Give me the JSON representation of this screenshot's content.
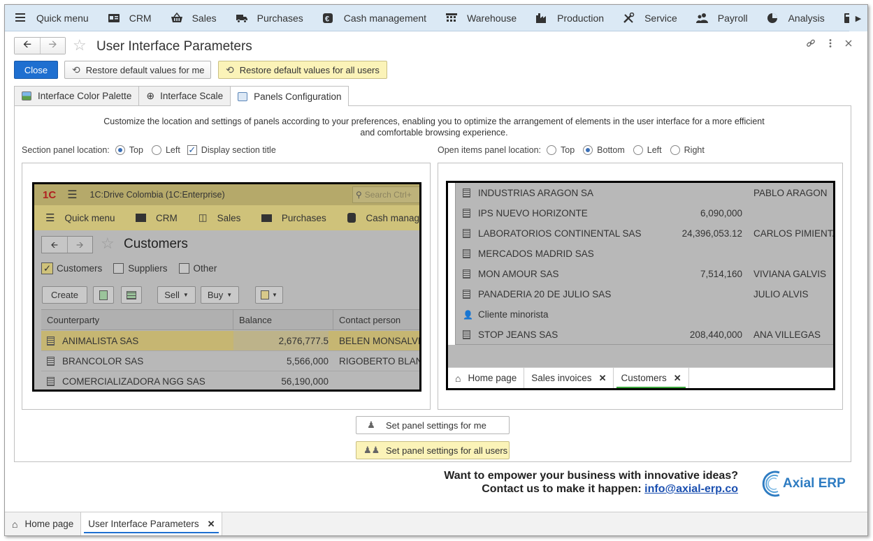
{
  "topmenu": {
    "items": [
      {
        "label": "Quick menu",
        "icon": "hamburger-icon"
      },
      {
        "label": "CRM",
        "icon": "crm-card-icon"
      },
      {
        "label": "Sales",
        "icon": "basket-icon"
      },
      {
        "label": "Purchases",
        "icon": "truck-icon"
      },
      {
        "label": "Cash management",
        "icon": "cash-icon"
      },
      {
        "label": "Warehouse",
        "icon": "warehouse-icon"
      },
      {
        "label": "Production",
        "icon": "factory-icon"
      },
      {
        "label": "Service",
        "icon": "tools-icon"
      },
      {
        "label": "Payroll",
        "icon": "people-icon"
      },
      {
        "label": "Analysis",
        "icon": "pie-chart-icon"
      }
    ]
  },
  "header": {
    "title": "User Interface Parameters"
  },
  "actions": {
    "close": "Close",
    "restore_me": "Restore default values for me",
    "restore_all": "Restore default values for all users"
  },
  "tabs": [
    {
      "label": "Interface Color Palette"
    },
    {
      "label": "Interface Scale"
    },
    {
      "label": "Panels Configuration"
    }
  ],
  "panels": {
    "description": "Customize the location and settings of panels according to your preferences, enabling you to optimize the arrangement of elements in the user interface for a more efficient and comfortable browsing experience.",
    "section_label": "Section panel location:",
    "section_options": [
      "Top",
      "Left"
    ],
    "section_selected": "Top",
    "display_title": "Display section title",
    "display_title_checked": true,
    "open_label": "Open items panel location:",
    "open_options": [
      "Top",
      "Bottom",
      "Left",
      "Right"
    ],
    "open_selected": "Bottom",
    "set_me": "Set panel settings for me",
    "set_all": "Set panel settings for all users"
  },
  "preview_left": {
    "app_title": "1C:Drive Colombia  (1C:Enterprise)",
    "search_placeholder": "Search Ctrl+",
    "menu": [
      "Quick menu",
      "CRM",
      "Sales",
      "Purchases",
      "Cash manag"
    ],
    "form_title": "Customers",
    "filters": [
      {
        "label": "Customers",
        "checked": true
      },
      {
        "label": "Suppliers",
        "checked": false
      },
      {
        "label": "Other",
        "checked": false
      }
    ],
    "buttons": {
      "create": "Create",
      "sell": "Sell",
      "buy": "Buy"
    },
    "columns": [
      "Counterparty",
      "Balance",
      "Contact person"
    ],
    "rows": [
      {
        "name": "ANIMALISTA SAS",
        "balance": "2,676,777.5",
        "contact": "BELEN MONSALVE"
      },
      {
        "name": "BRANCOLOR SAS",
        "balance": "5,566,000",
        "contact": "RIGOBERTO BLAN"
      },
      {
        "name": "COMERCIALIZADORA NGG SAS",
        "balance": "56,190,000",
        "contact": ""
      }
    ]
  },
  "preview_right": {
    "rows": [
      {
        "name": "INDUSTRIAS ARAGON SA",
        "balance": "",
        "contact": "PABLO ARAGON",
        "icon": "building-icon"
      },
      {
        "name": "IPS NUEVO HORIZONTE",
        "balance": "6,090,000",
        "contact": "",
        "icon": "building-icon"
      },
      {
        "name": "LABORATORIOS CONTINENTAL SAS",
        "balance": "24,396,053.12",
        "contact": "CARLOS PIMIENTA",
        "icon": "building-icon"
      },
      {
        "name": "MERCADOS MADRID SAS",
        "balance": "",
        "contact": "",
        "icon": "building-icon"
      },
      {
        "name": "MON AMOUR SAS",
        "balance": "7,514,160",
        "contact": "VIVIANA GALVIS",
        "icon": "building-icon"
      },
      {
        "name": "PANADERIA 20 DE JULIO SAS",
        "balance": "",
        "contact": "JULIO ALVIS",
        "icon": "building-icon"
      },
      {
        "name": "Cliente minorista",
        "balance": "",
        "contact": "",
        "icon": "person-icon"
      },
      {
        "name": "STOP JEANS SAS",
        "balance": "208,440,000",
        "contact": "ANA VILLEGAS",
        "icon": "building-icon"
      }
    ],
    "tabs": [
      "Home page",
      "Sales invoices",
      "Customers"
    ]
  },
  "promo": {
    "line1": "Want to empower your business with innovative ideas?",
    "line2": "Contact us to make it happen: ",
    "email": "info@axial-erp.co",
    "brand": "Axial ERP"
  },
  "bottombar": {
    "tabs": [
      "Home page",
      "User Interface Parameters"
    ]
  }
}
